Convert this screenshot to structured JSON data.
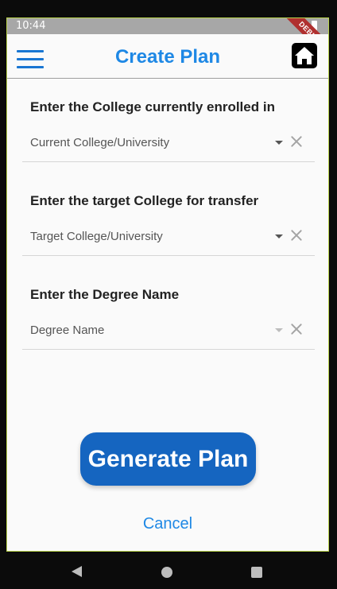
{
  "status_bar": {
    "time": "10:44",
    "debug_label": "DEBUG"
  },
  "app_bar": {
    "title": "Create Plan",
    "menu_icon": "hamburger-menu-icon",
    "home_icon": "home-icon"
  },
  "fields": [
    {
      "label": "Enter the College currently enrolled in",
      "value": "Current College/University",
      "enabled": true
    },
    {
      "label": "Enter the target College for transfer",
      "value": "Target College/University",
      "enabled": true
    },
    {
      "label": "Enter the Degree Name",
      "value": "Degree Name",
      "enabled": false
    }
  ],
  "actions": {
    "primary": "Generate Plan",
    "secondary": "Cancel"
  },
  "colors": {
    "accent": "#1e88e5",
    "button": "#1565c0",
    "frame_border": "#b9d34a"
  },
  "nav_bar": {
    "icons": [
      "back-icon",
      "home-circle-icon",
      "recent-apps-icon"
    ]
  }
}
